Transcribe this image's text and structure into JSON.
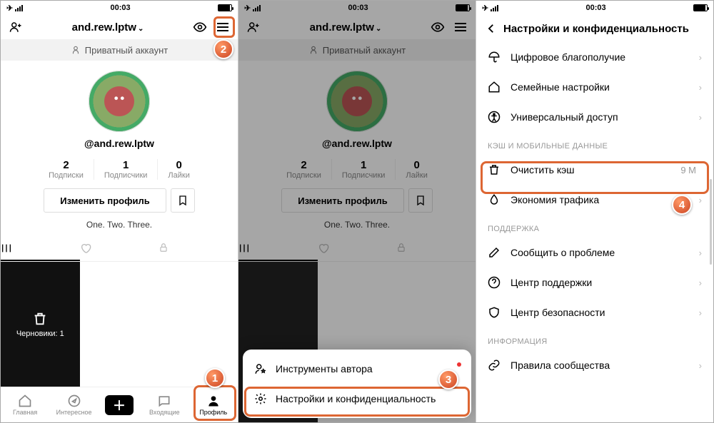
{
  "status": {
    "time": "00:03"
  },
  "profile": {
    "username_dropdown": "and.rew.lptw",
    "private_label": "Приватный аккаунт",
    "handle": "@and.rew.lptw",
    "stats": {
      "following": {
        "num": "2",
        "lbl": "Подписки"
      },
      "followers": {
        "num": "1",
        "lbl": "Подписчики"
      },
      "likes": {
        "num": "0",
        "lbl": "Лайки"
      }
    },
    "edit_btn": "Изменить профиль",
    "bio": "One. Two. Three.",
    "drafts": "Черновики: 1"
  },
  "nav": {
    "home": "Главная",
    "discover": "Интересное",
    "inbox": "Входящие",
    "profile": "Профиль"
  },
  "sheet": {
    "creator_tools": "Инструменты автора",
    "settings": "Настройки и конфиденциальность"
  },
  "settings": {
    "title": "Настройки и конфиденциальность",
    "digital_wellbeing": "Цифровое благополучие",
    "family": "Семейные настройки",
    "accessibility": "Универсальный доступ",
    "section_cache": "КЭШ И МОБИЛЬНЫЕ ДАННЫЕ",
    "clear_cache": "Очистить кэш",
    "clear_cache_val": "9 M",
    "data_saver": "Экономия трафика",
    "section_support": "ПОДДЕРЖКА",
    "report": "Сообщить о проблеме",
    "help": "Центр поддержки",
    "safety": "Центр безопасности",
    "section_info": "ИНФОРМАЦИЯ",
    "guidelines": "Правила сообщества"
  }
}
